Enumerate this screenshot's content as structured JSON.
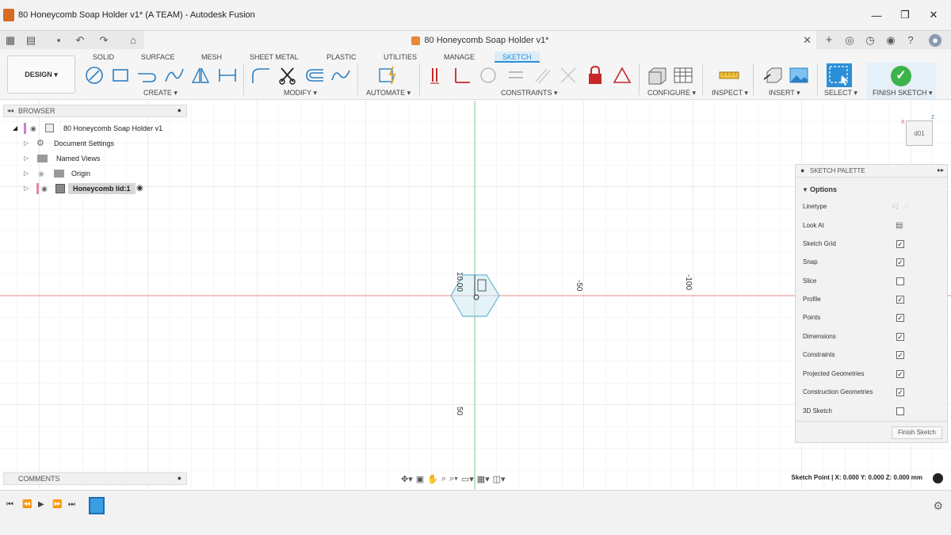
{
  "window": {
    "title": "80 Honeycomb Soap Holder v1* (A TEAM) - Autodesk Fusion",
    "minimize": "—",
    "maximize": "❐",
    "close": "✕"
  },
  "quickbar": {
    "doc_tab_title": "80 Honeycomb Soap Holder v1*",
    "doc_tab_close": "✕"
  },
  "ribbon": {
    "workspace": "DESIGN ▾",
    "tabs": [
      "SOLID",
      "SURFACE",
      "MESH",
      "SHEET METAL",
      "PLASTIC",
      "UTILITIES",
      "MANAGE",
      "SKETCH"
    ],
    "active_tab": "SKETCH",
    "groups": [
      "CREATE ▾",
      "MODIFY ▾",
      "AUTOMATE ▾",
      "CONSTRAINTS ▾",
      "CONFIGURE ▾",
      "INSPECT ▾",
      "INSERT ▾",
      "SELECT ▾",
      "FINISH SKETCH ▾"
    ],
    "accent": "#2a8fd6",
    "finish_color": "#3db34b"
  },
  "browser": {
    "header": "BROWSER",
    "items": [
      {
        "label": "80 Honeycomb Soap Holder v1",
        "icon": "document-icon"
      },
      {
        "label": "Document Settings",
        "icon": "gear-icon"
      },
      {
        "label": "Named Views",
        "icon": "folder-icon"
      },
      {
        "label": "Origin",
        "icon": "folder-icon"
      },
      {
        "label": "Honeycomb lid:1",
        "icon": "component-icon"
      }
    ]
  },
  "canvas": {
    "axis_labels": [
      "-50",
      "-100",
      "50"
    ],
    "sketch_dim": "10.00",
    "view_cube_label": "d01",
    "axis_x": "X",
    "axis_z": "Z"
  },
  "palette": {
    "header": "SKETCH PALETTE",
    "section": "Options",
    "options": [
      {
        "label": "Linetype",
        "type": "icons"
      },
      {
        "label": "Look At",
        "type": "icon"
      },
      {
        "label": "Sketch Grid",
        "type": "check",
        "checked": true
      },
      {
        "label": "Snap",
        "type": "check",
        "checked": true
      },
      {
        "label": "Slice",
        "type": "check",
        "checked": false
      },
      {
        "label": "Profile",
        "type": "check",
        "checked": true
      },
      {
        "label": "Points",
        "type": "check",
        "checked": true
      },
      {
        "label": "Dimensions",
        "type": "check",
        "checked": true
      },
      {
        "label": "Constraints",
        "type": "check",
        "checked": true
      },
      {
        "label": "Projected Geometries",
        "type": "check",
        "checked": true
      },
      {
        "label": "Construction Geometries",
        "type": "check",
        "checked": true
      },
      {
        "label": "3D Sketch",
        "type": "check",
        "checked": false
      }
    ],
    "finish_button": "Finish Sketch"
  },
  "comments": {
    "header": "COMMENTS"
  },
  "status": {
    "text": "Sketch Point | X: 0.000 Y: 0.000 Z: 0.000 mm"
  }
}
